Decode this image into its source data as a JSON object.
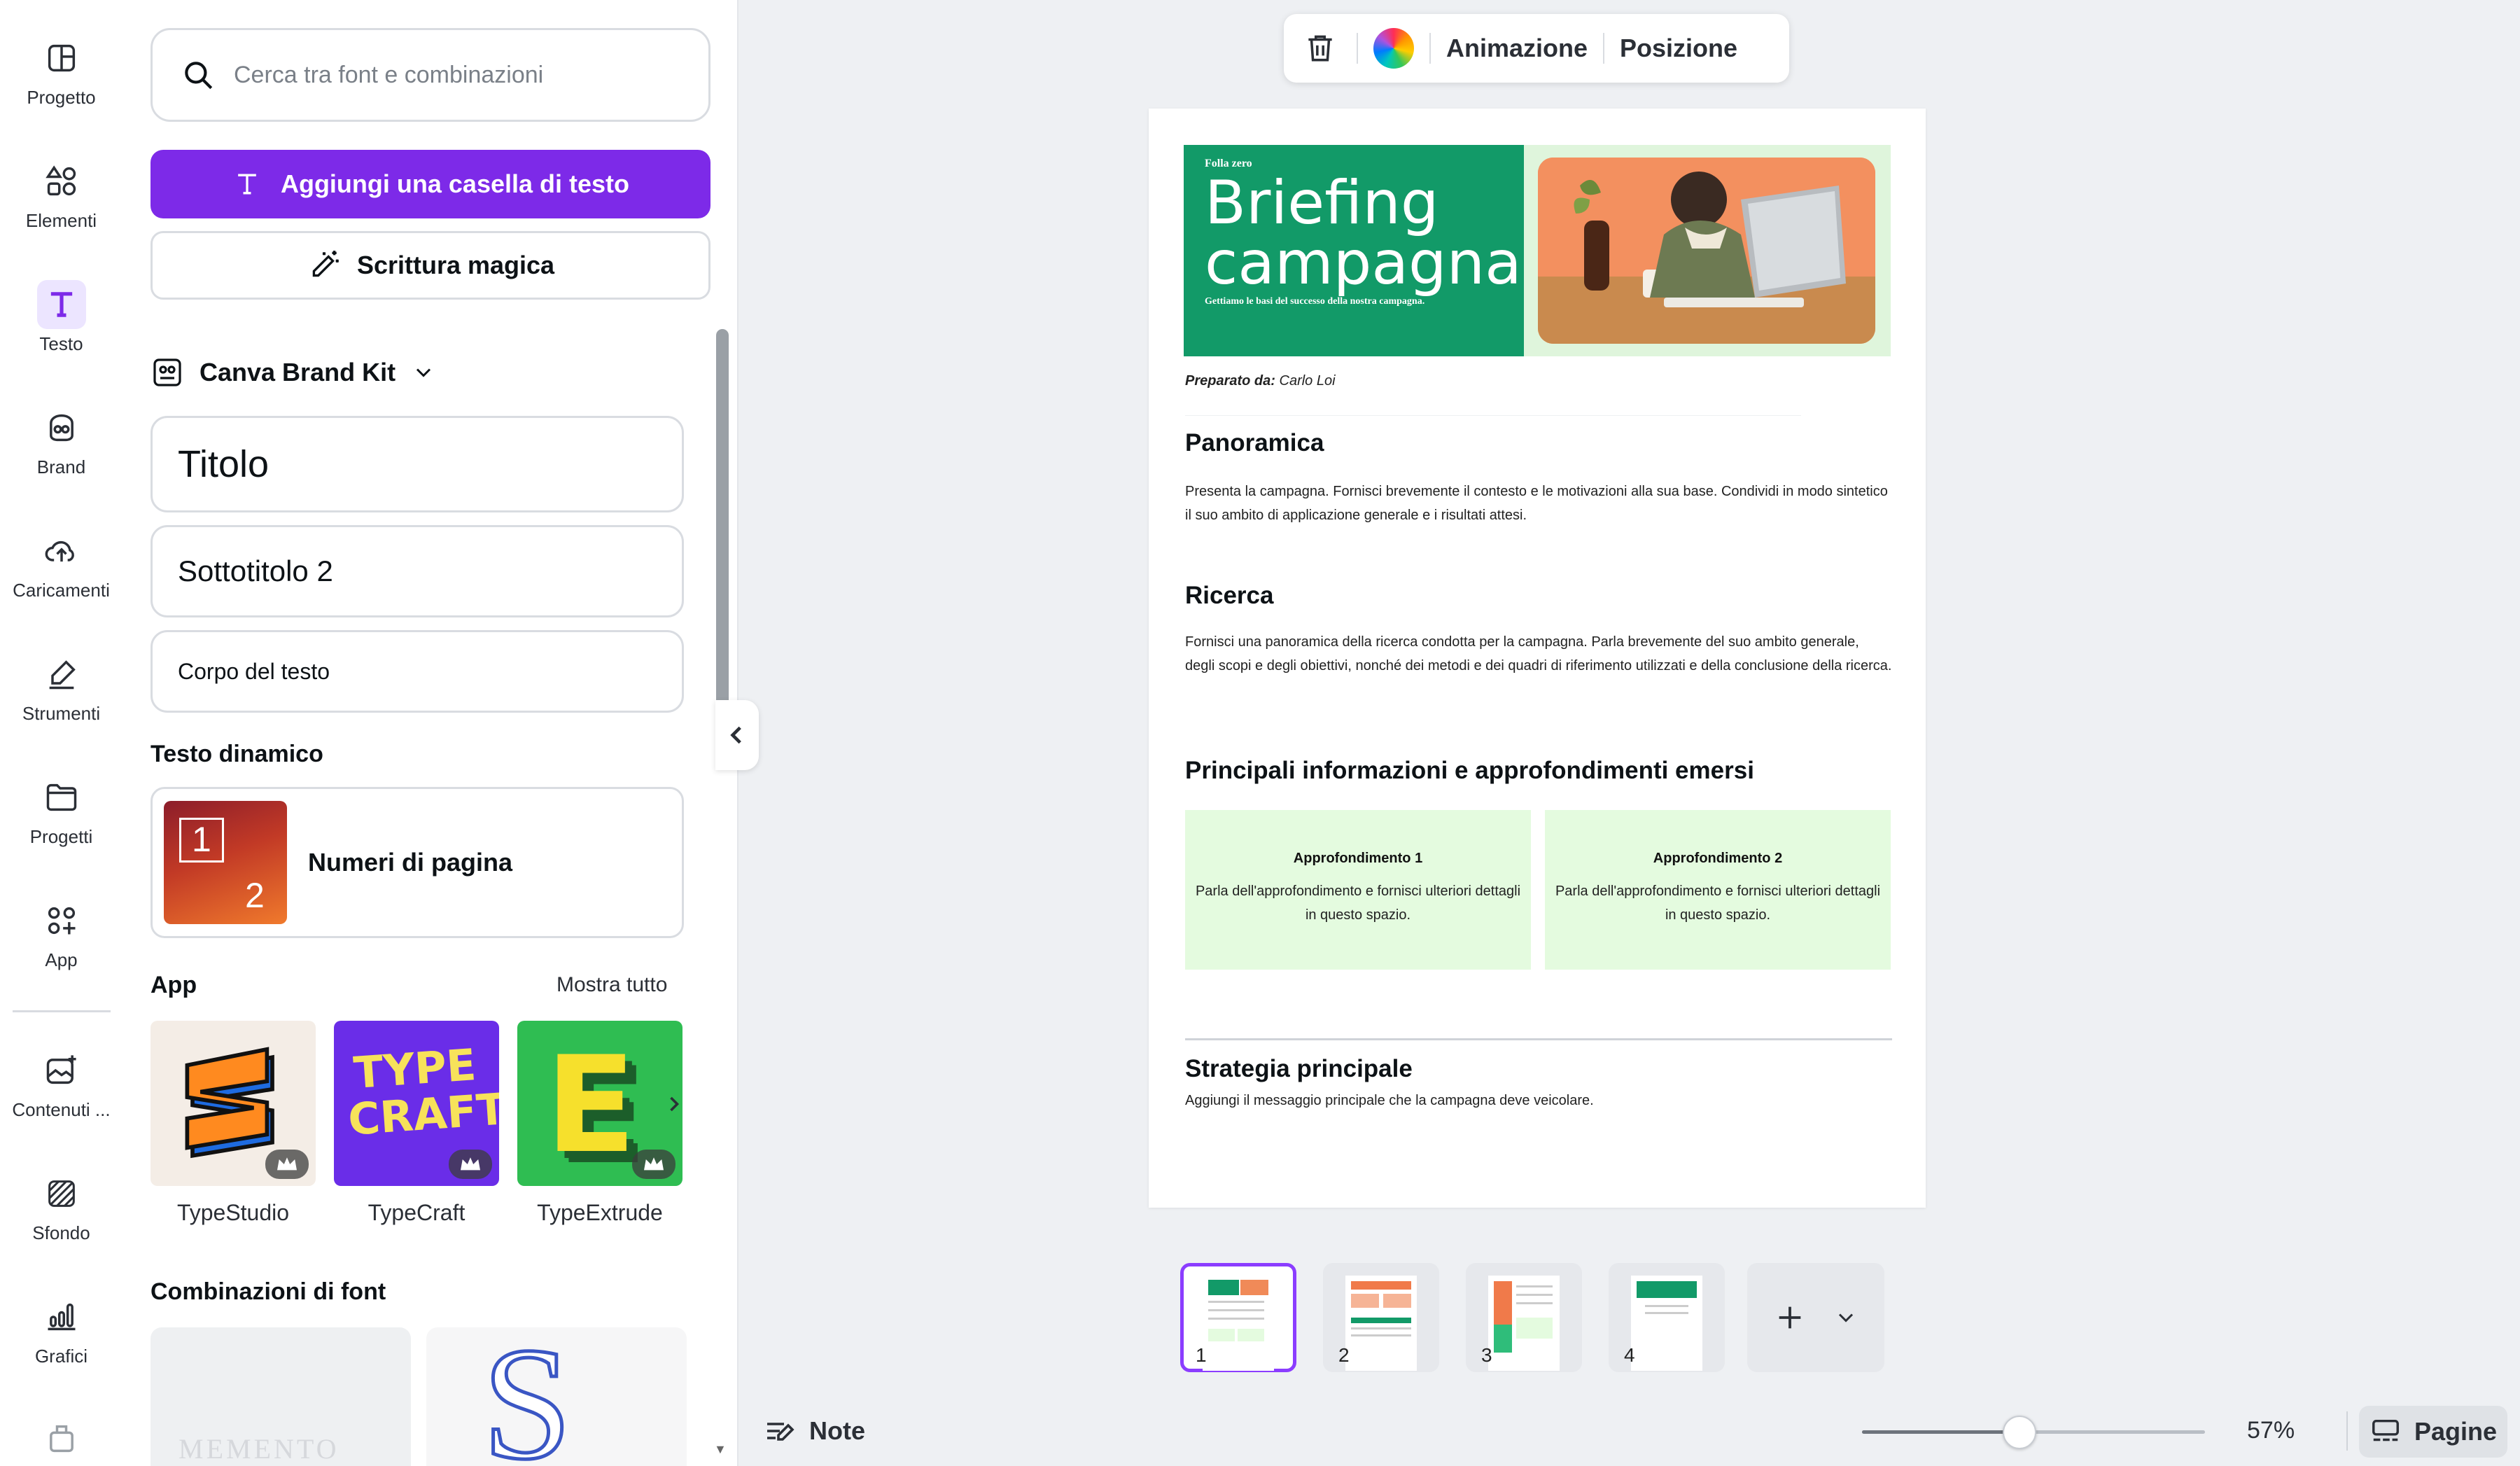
{
  "rail": {
    "items": [
      {
        "label": "Progetto",
        "icon": "layout-icon"
      },
      {
        "label": "Elementi",
        "icon": "shapes-icon"
      },
      {
        "label": "Testo",
        "icon": "text-icon"
      },
      {
        "label": "Brand",
        "icon": "brand-icon"
      },
      {
        "label": "Caricamenti",
        "icon": "cloud-upload-icon"
      },
      {
        "label": "Strumenti",
        "icon": "pen-icon"
      },
      {
        "label": "Progetti",
        "icon": "folder-icon"
      },
      {
        "label": "App",
        "icon": "apps-grid-icon"
      },
      {
        "label": "Contenuti ...",
        "icon": "media-icon"
      },
      {
        "label": "Sfondo",
        "icon": "stripes-icon"
      },
      {
        "label": "Grafici",
        "icon": "bar-chart-icon"
      }
    ],
    "active_index": 2
  },
  "panel": {
    "search_placeholder": "Cerca tra font e combinazioni",
    "add_text_label": "Aggiungi una casella di testo",
    "magic_label": "Scrittura magica",
    "brand_kit_label": "Canva Brand Kit",
    "presets": {
      "title": "Titolo",
      "subtitle": "Sottotitolo 2",
      "body": "Corpo del testo"
    },
    "dynamic_heading": "Testo dinamico",
    "dynamic_item": {
      "label": "Numeri di pagina",
      "thumb_numbers": [
        "1",
        "2"
      ]
    },
    "apps_heading": "App",
    "show_all": "Mostra tutto",
    "apps": [
      {
        "name": "TypeStudio"
      },
      {
        "name": "TypeCraft",
        "art_text": "TYPE CRAFT"
      },
      {
        "name": "TypeExtrude",
        "art_text": "E"
      }
    ],
    "font_combos_heading": "Combinazioni di font",
    "font_combo_samples": [
      "MEMENTO",
      "S"
    ]
  },
  "toolbar": {
    "animation": "Animazione",
    "position": "Posizione"
  },
  "doc": {
    "hero": {
      "brand": "Folla zero",
      "title": "Briefing campagna",
      "tagline": "Gettiamo le basi del successo della nostra campagna."
    },
    "prepared_label": "Preparato da:",
    "prepared_name": "Carlo Loi",
    "sections": {
      "overview_title": "Panoramica",
      "overview_text": "Presenta la campagna. Fornisci brevemente il contesto e le motivazioni alla sua base. Condividi in modo sintetico il suo ambito di applicazione generale e i risultati attesi.",
      "research_title": "Ricerca",
      "research_text": "Fornisci una panoramica della ricerca condotta per la campagna. Parla brevemente del suo ambito generale, degli scopi e degli obiettivi, nonché dei metodi e dei quadri di riferimento utilizzati e della conclusione della ricerca.",
      "insights_title": "Principali informazioni e approfondimenti emersi",
      "insights": [
        {
          "title": "Approfondimento 1",
          "text": "Parla dell'approfondimento e fornisci ulteriori dettagli in questo spazio."
        },
        {
          "title": "Approfondimento 2",
          "text": "Parla dell'approfondimento e fornisci ulteriori dettagli in questo spazio."
        }
      ],
      "strategy_title": "Strategia principale",
      "strategy_text": "Aggiungi il messaggio principale che la campagna deve veicolare."
    }
  },
  "pages": {
    "thumbnails": [
      "1",
      "2",
      "3",
      "4"
    ],
    "active": "1"
  },
  "bottom": {
    "notes": "Note",
    "zoom": "57%",
    "zoom_level": 0.46,
    "pages": "Pagine"
  },
  "colors": {
    "accent": "#7d2ae8",
    "doc_green": "#129a68",
    "insight_bg": "#e4fbdf"
  }
}
